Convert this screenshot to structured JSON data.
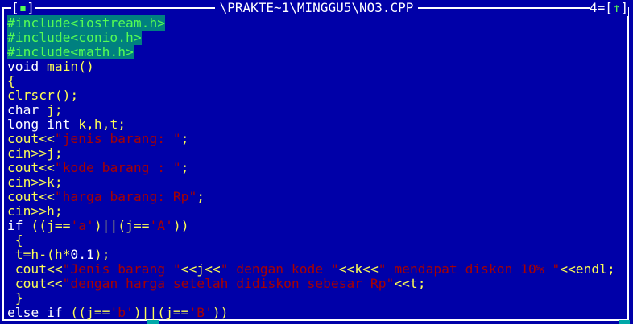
{
  "window": {
    "close_open": "[",
    "close_mark": "▪",
    "close_close": "]",
    "title": "\\PRAKTE~1\\MINGGU5\\NO3.CPP",
    "number": "4",
    "zoom_open": "=[",
    "zoom_arrow": "↑",
    "zoom_close": "]"
  },
  "colors": {
    "background": "#0000a8",
    "preprocessor_bg": "#008080",
    "preprocessor_fg": "#54fc54",
    "identifier": "#fcfc54",
    "string": "#a80000",
    "keyword": "#ffffff"
  },
  "code": {
    "lines": [
      [
        {
          "t": "#include<iostream.h>",
          "c": "pp"
        }
      ],
      [
        {
          "t": "#include<conio.h>",
          "c": "pp"
        }
      ],
      [
        {
          "t": "#include<math.h>",
          "c": "pp"
        }
      ],
      [
        {
          "t": "void ",
          "c": "kw"
        },
        {
          "t": "main()",
          "c": "id"
        }
      ],
      [
        {
          "t": "{",
          "c": "id"
        }
      ],
      [
        {
          "t": "clrscr();",
          "c": "id"
        }
      ],
      [
        {
          "t": "char ",
          "c": "kw"
        },
        {
          "t": "j;",
          "c": "id"
        }
      ],
      [
        {
          "t": "long int ",
          "c": "kw"
        },
        {
          "t": "k,h,t;",
          "c": "id"
        }
      ],
      [
        {
          "t": "cout<<",
          "c": "id"
        },
        {
          "t": "\"jenis barang: \"",
          "c": "st"
        },
        {
          "t": ";",
          "c": "id"
        }
      ],
      [
        {
          "t": "cin>>j;",
          "c": "id"
        }
      ],
      [
        {
          "t": "cout<<",
          "c": "id"
        },
        {
          "t": "\"kode barang : \"",
          "c": "st"
        },
        {
          "t": ";",
          "c": "id"
        }
      ],
      [
        {
          "t": "cin>>k;",
          "c": "id"
        }
      ],
      [
        {
          "t": "cout<<",
          "c": "id"
        },
        {
          "t": "\"harga barang: Rp\"",
          "c": "st"
        },
        {
          "t": ";",
          "c": "id"
        }
      ],
      [
        {
          "t": "cin>>h;",
          "c": "id"
        }
      ],
      [
        {
          "t": "if ",
          "c": "kw"
        },
        {
          "t": "((j==",
          "c": "id"
        },
        {
          "t": "'a'",
          "c": "st"
        },
        {
          "t": ")||(j==",
          "c": "id"
        },
        {
          "t": "'A'",
          "c": "st"
        },
        {
          "t": "))",
          "c": "id"
        }
      ],
      [
        {
          "t": " {",
          "c": "id"
        }
      ],
      [
        {
          "t": " t=h-(h*",
          "c": "id"
        },
        {
          "t": "0.1",
          "c": "kw"
        },
        {
          "t": ");",
          "c": "id"
        }
      ],
      [
        {
          "t": " cout<<",
          "c": "id"
        },
        {
          "t": "\"Jenis barang \"",
          "c": "st"
        },
        {
          "t": "<<j<<",
          "c": "id"
        },
        {
          "t": "\" dengan kode \"",
          "c": "st"
        },
        {
          "t": "<<k<<",
          "c": "id"
        },
        {
          "t": "\" mendapat diskon 10% \"",
          "c": "st"
        },
        {
          "t": "<<endl;",
          "c": "id"
        }
      ],
      [
        {
          "t": " cout<<",
          "c": "id"
        },
        {
          "t": "\"dengan harga setelah didiskon sebesar Rp\"",
          "c": "st"
        },
        {
          "t": "<<t;",
          "c": "id"
        }
      ],
      [
        {
          "t": " }",
          "c": "id"
        }
      ],
      [
        {
          "t": "else if ",
          "c": "kw"
        },
        {
          "t": "((j==",
          "c": "id"
        },
        {
          "t": "'b'",
          "c": "st"
        },
        {
          "t": ")||(j==",
          "c": "id"
        },
        {
          "t": "'B'",
          "c": "st"
        },
        {
          "t": "))",
          "c": "id"
        }
      ]
    ]
  }
}
